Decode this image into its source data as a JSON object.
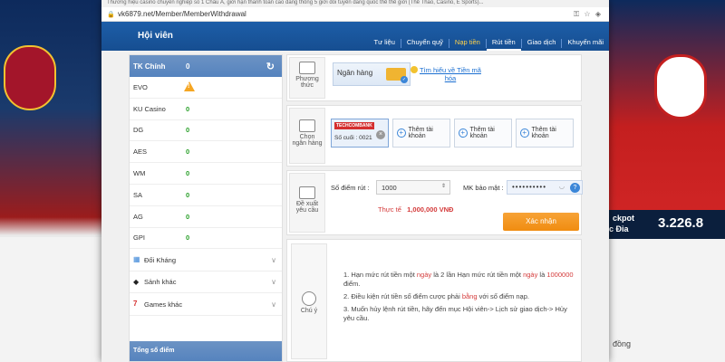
{
  "browser": {
    "title_strip": "Thương hiệu casino chuyên nghiệp số 1 Châu Á, giới hạn thanh toán cao đẳng thông 5 giới đối tuyển đẳng quốc thể thể giới (Thể Thao, Casino, E Sports)...",
    "url": "vk6879.net/Member/MemberWithdrawal"
  },
  "header": {
    "title": "Hội viên",
    "nav": [
      "Tư liệu",
      "Chuyển quỹ",
      "Nạp tiền",
      "Rút tiền",
      "Giao dịch",
      "Khuyến mãi"
    ]
  },
  "wallets": {
    "main_label": "TK Chính",
    "main_balance": "0",
    "items": [
      {
        "name": "EVO",
        "value": ""
      },
      {
        "name": "KU Casino",
        "value": "0"
      },
      {
        "name": "DG",
        "value": "0"
      },
      {
        "name": "AES",
        "value": "0"
      },
      {
        "name": "WM",
        "value": "0"
      },
      {
        "name": "SA",
        "value": "0"
      },
      {
        "name": "AG",
        "value": "0"
      },
      {
        "name": "GPI",
        "value": "0"
      }
    ],
    "groups": [
      "Đối Kháng",
      "Sảnh khác",
      "Games khác"
    ],
    "total_label": "Tổng số điểm"
  },
  "method": {
    "icon_label_1": "Phương",
    "icon_label_2": "thức",
    "selected": "Ngân hàng",
    "learn_1": "Tìm hiểu về Tiền mã",
    "learn_2": "hóa"
  },
  "bank": {
    "icon_label_1": "Chọn",
    "icon_label_2": "ngân hàng",
    "bank_logo": "TECHCOMBANK",
    "last_digits": "Số cuối : 0021",
    "add_label": "Thêm tài khoản"
  },
  "withdraw": {
    "icon_label_1": "Đề xuất",
    "icon_label_2": "yêu cầu",
    "points_label": "Số điểm rút :",
    "points_value": "1000",
    "pw_label": "MK bảo mật :",
    "pw_value": "••••••••••",
    "actual_label": "Thực tế",
    "actual_value": "1,000,000 VNĐ",
    "confirm": "Xác nhận"
  },
  "notes": {
    "icon_label": "Chú ý",
    "n1_a": "1.  Hạn mức rút tiền một ",
    "n1_b": "ngày",
    "n1_c": " là 2 lần Hạn mức rút tiền một ",
    "n1_d": "ngày",
    "n1_e": " là ",
    "n1_f": "1000000",
    "n1_g": " điểm.",
    "n2_a": "2.  Điều kiện rút tiền số điểm cược phải ",
    "n2_b": "bằng",
    "n2_c": " với số điểm nạp.",
    "n3": "3.  Muốn hủy lệnh rút tiền, hãy đến mục Hội viên-> Lịch sử giao dịch-> Hủy yêu cầu."
  },
  "background": {
    "jackpot_1": "ckpot",
    "jackpot_2": "c Đỉa",
    "jackpot_amount": "3.226.8",
    "dong": "đồng"
  },
  "colors": {
    "header_blue": "#1d5ea8",
    "accent_orange": "#f08c10",
    "active_nav": "#ffd24a",
    "balance_green": "#2aa02a"
  }
}
